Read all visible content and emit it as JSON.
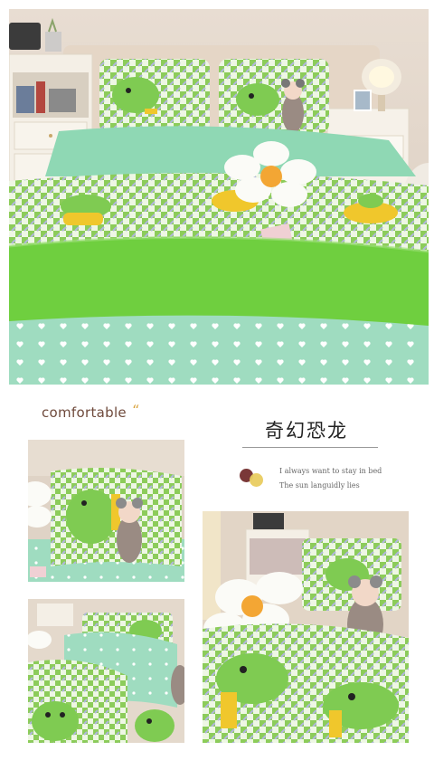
{
  "decor_text": {
    "label": "comfortable",
    "quote_mark": "“"
  },
  "product": {
    "title_cn": "奇幻恐龙",
    "tagline_1": "I always want to stay in bed",
    "tagline_2": "The sun languidly lies"
  },
  "palette": {
    "mint": "#8fd8b4",
    "leaf_green": "#6fcf3f",
    "dino_green": "#7fcb52",
    "scooter_yellow": "#f0c72c",
    "accent_red": "#7a3838",
    "accent_yellow": "#e9cc60"
  },
  "photos": [
    {
      "name": "hero-bedroom-photo",
      "subject": "bed with green dinosaur bedding"
    },
    {
      "name": "pillow-closeup-photo",
      "subject": "pillow with doll"
    },
    {
      "name": "duvet-detail-photo",
      "subject": "dinosaur print duvet"
    },
    {
      "name": "bed-corner-photo",
      "subject": "bed corner with flower cushion"
    }
  ]
}
